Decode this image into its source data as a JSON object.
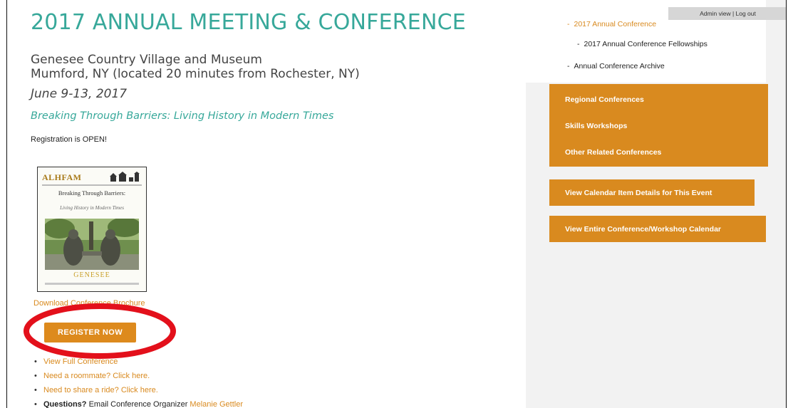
{
  "main": {
    "title": "2017 ANNUAL MEETING & CONFERENCE",
    "venue_line1": "Genesee Country Village and Museum",
    "venue_line2": "Mumford, NY (located 20 minutes from Rochester, NY)",
    "dates": "June 9-13, 2017",
    "theme": "Breaking Through Barriers: Living History in Modern Times",
    "registration_status": "Registration is OPEN!",
    "cover": {
      "brand": "ALHFAM",
      "title_line1": "Breaking Through Barriers:",
      "title_line2": "Living History in Modern Times",
      "wordmark": "GENESEE"
    },
    "download_text": "Download Conference Brochure",
    "register_button": "REGISTER NOW",
    "links": [
      {
        "text": "View Full Conference"
      },
      {
        "text": "Need a roommate? Click here."
      },
      {
        "text": "Need to share a ride? Click here."
      },
      {
        "strong": "Questions?",
        "text": " Email Conference Organizer ",
        "link": "Melanie Gettler"
      }
    ]
  },
  "sidebar": {
    "admin_bar": "Admin view  |  Log out",
    "subnav": [
      {
        "label": "2017 Annual Conference"
      },
      {
        "label": "2017 Annual Conference Fellowships"
      },
      {
        "label": "Annual Conference Archive"
      }
    ],
    "menu": [
      {
        "label": "Regional Conferences"
      },
      {
        "label": "Skills Workshops"
      },
      {
        "label": "Other Related Conferences"
      }
    ],
    "buttons": [
      {
        "label": "View Calendar Item Details for This Event"
      },
      {
        "label": "View Entire Conference/Workshop Calendar"
      }
    ]
  },
  "colors": {
    "teal_heading": "#37a89a",
    "orange_accent": "#d98a1f",
    "annotation_red": "#e3101b",
    "sidebar_bg": "#f2f2f2"
  },
  "icons": {
    "cover_logo": "village-buildings-icon",
    "annotation": "red-circle-annotation"
  }
}
